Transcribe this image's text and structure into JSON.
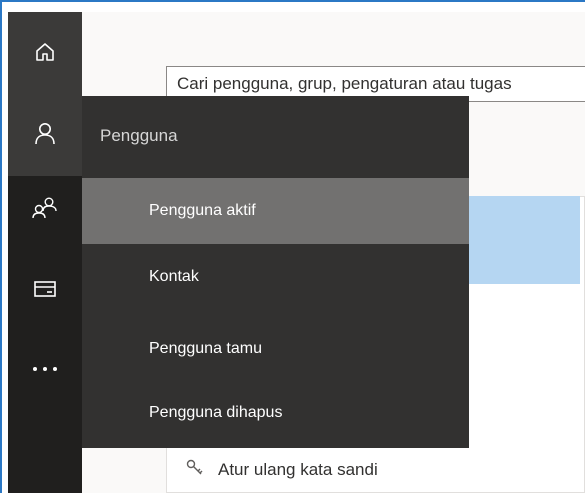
{
  "search": {
    "text": "Cari pengguna, grup, pengaturan atau tugas"
  },
  "flyout": {
    "title": "Pengguna",
    "items": [
      {
        "label": "Pengguna aktif",
        "active": true
      },
      {
        "label": "Kontak",
        "active": false
      },
      {
        "label": "Pengguna tamu",
        "active": false
      },
      {
        "label": "Pengguna dihapus",
        "active": false
      }
    ]
  },
  "card": {
    "reset_password_label": "Atur ulang kata sandi"
  },
  "nav": {
    "icons": [
      "home-icon",
      "user-icon",
      "groups-icon",
      "billing-icon",
      "more-icon"
    ]
  },
  "colors": {
    "accent": "#2b78c5",
    "rail_bg": "#201f1e",
    "flyout_bg": "#323130",
    "active_item_bg": "#727170",
    "selected_row_bg": "#b5d6f2"
  }
}
